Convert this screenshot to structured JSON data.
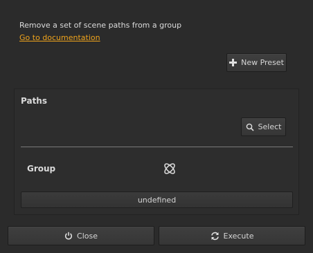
{
  "header": {
    "description": "Remove a set of scene paths from a group",
    "doc_link": "Go to documentation"
  },
  "toolbar": {
    "new_preset_label": "New Preset",
    "new_preset_icon": "plus-icon"
  },
  "panel": {
    "title": "Paths",
    "select_label": "Select",
    "select_icon": "search-icon",
    "group_label": "Group",
    "group_icon": "group-knot-icon",
    "group_value": "undefined"
  },
  "footer": {
    "close_label": "Close",
    "close_icon": "power-icon",
    "execute_label": "Execute",
    "execute_icon": "refresh-icon"
  },
  "colors": {
    "background": "#2b2b2b",
    "link": "#f0a41c",
    "text": "#d2d2d2"
  }
}
